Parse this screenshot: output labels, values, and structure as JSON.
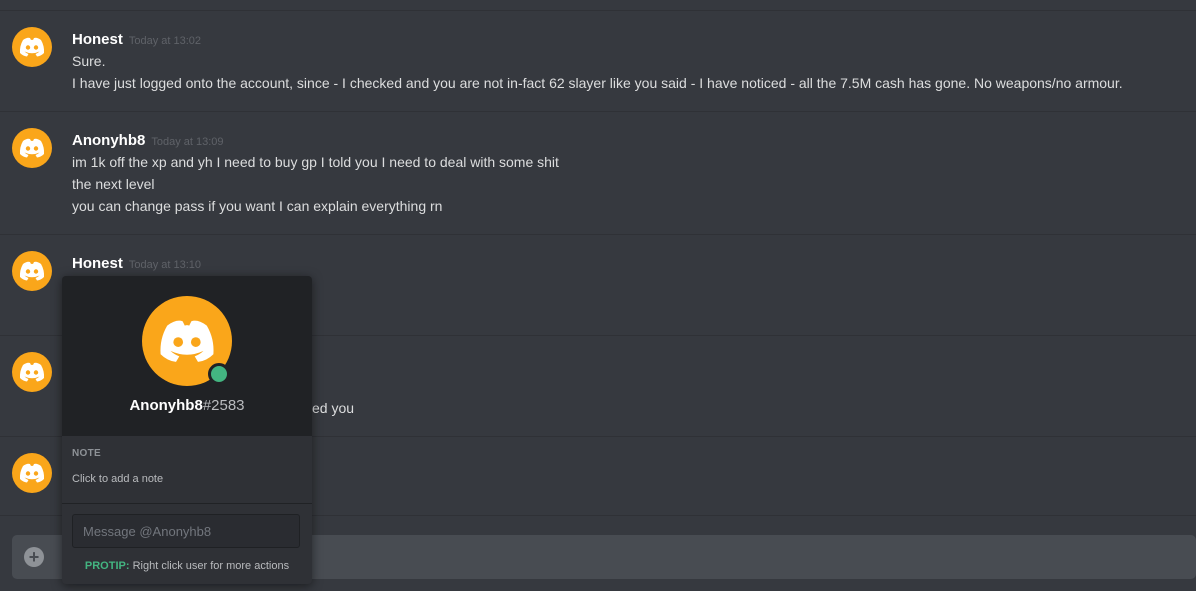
{
  "colors": {
    "background": "#36393f",
    "avatar": "#faa61a",
    "online": "#43b581",
    "protip": "#43b581"
  },
  "messages": [
    {
      "username": "Honest",
      "timestamp": "Today at 13:02",
      "lines": [
        "Sure.",
        "I have just logged onto the account, since - I checked and you are not in-fact 62 slayer like you said - I have noticed - all the 7.5M cash has gone. No weapons/no armour."
      ]
    },
    {
      "username": "Anonyhb8",
      "timestamp": "Today at 13:09",
      "lines": [
        "im 1k off the xp and yh I need to buy gp I told you I need to deal with some shit",
        "the next level",
        "you can change pass if you want I can explain everything rn"
      ]
    },
    {
      "username": "Honest",
      "timestamp": "Today at 13:10",
      "lines": []
    },
    {
      "username": "",
      "timestamp": "",
      "lines": [
        "ed you"
      ]
    },
    {
      "username": "",
      "timestamp": "",
      "lines": []
    }
  ],
  "profile_popout": {
    "username": "Anonyhb8",
    "discriminator": "#2583",
    "avatar_icon": "discord-logo-icon",
    "status": "online",
    "note_label": "NOTE",
    "note_placeholder": "Click to add a note",
    "message_placeholder": "Message @Anonyhb8",
    "protip_label": "PROTIP:",
    "protip_text": " Right click user for more actions"
  },
  "composer": {
    "add_icon": "plus-icon"
  }
}
